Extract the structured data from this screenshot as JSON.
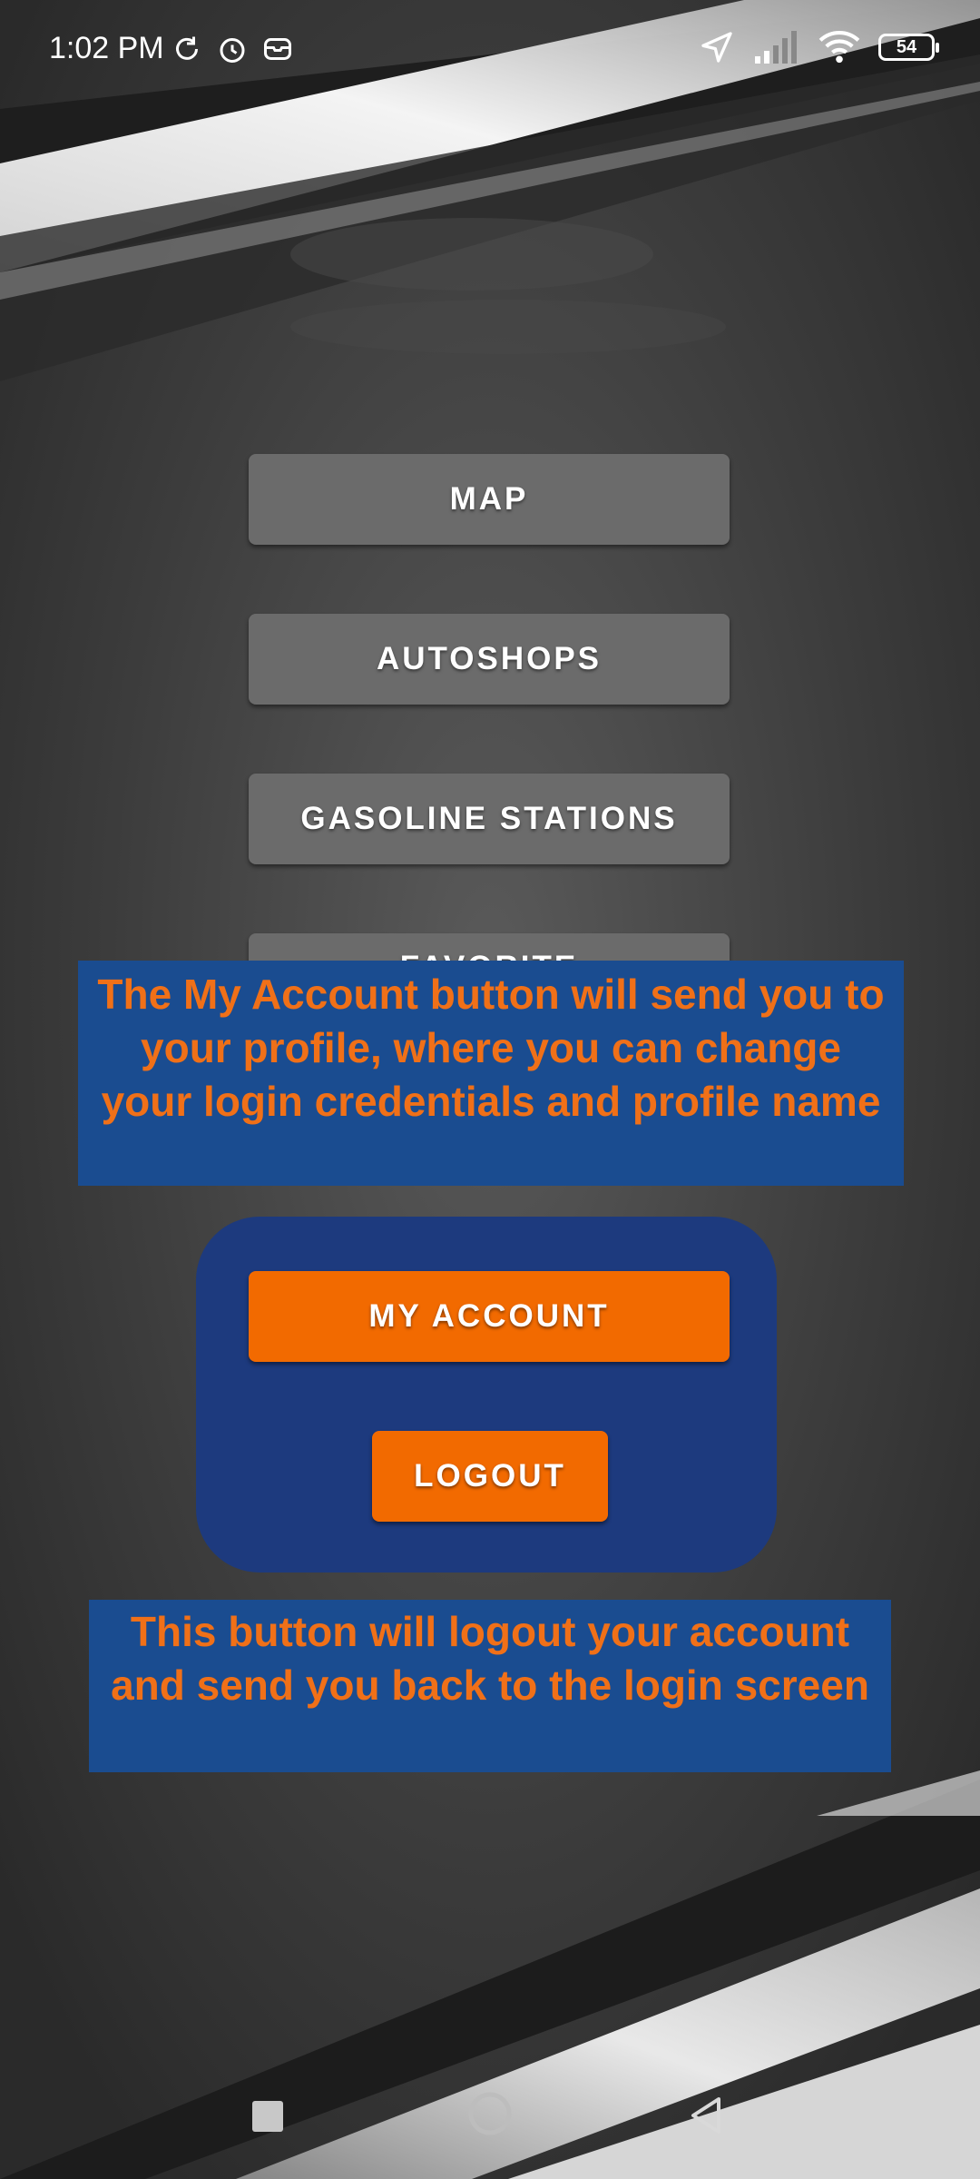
{
  "status_bar": {
    "time": "1:02 PM",
    "battery": "54",
    "icons": [
      "refresh-icon",
      "alarm-icon",
      "message-icon",
      "location-arrow-icon",
      "signal-icon",
      "wifi-icon",
      "battery-icon"
    ]
  },
  "menu": {
    "map": "MAP",
    "autoshops": "AUTOSHOPS",
    "gasoline": "GASOLINE STATIONS",
    "favorite": "FAVORITE",
    "my_account": "MY ACCOUNT",
    "logout": "LOGOUT"
  },
  "annotations": {
    "my_account_note": "The My Account button will send you to your profile, where you can change your login credentials and profile name",
    "logout_note": "This button will logout your account and send you back to the login screen"
  },
  "colors": {
    "annotation_bg": "#1a4c90",
    "annotation_text": "#f07018",
    "highlight": "#1c3a80",
    "primary_button": "#f26a00",
    "menu_button": "#6b6b6b"
  },
  "nav": {
    "icons": [
      "recent-apps-icon",
      "home-icon",
      "back-icon"
    ]
  }
}
